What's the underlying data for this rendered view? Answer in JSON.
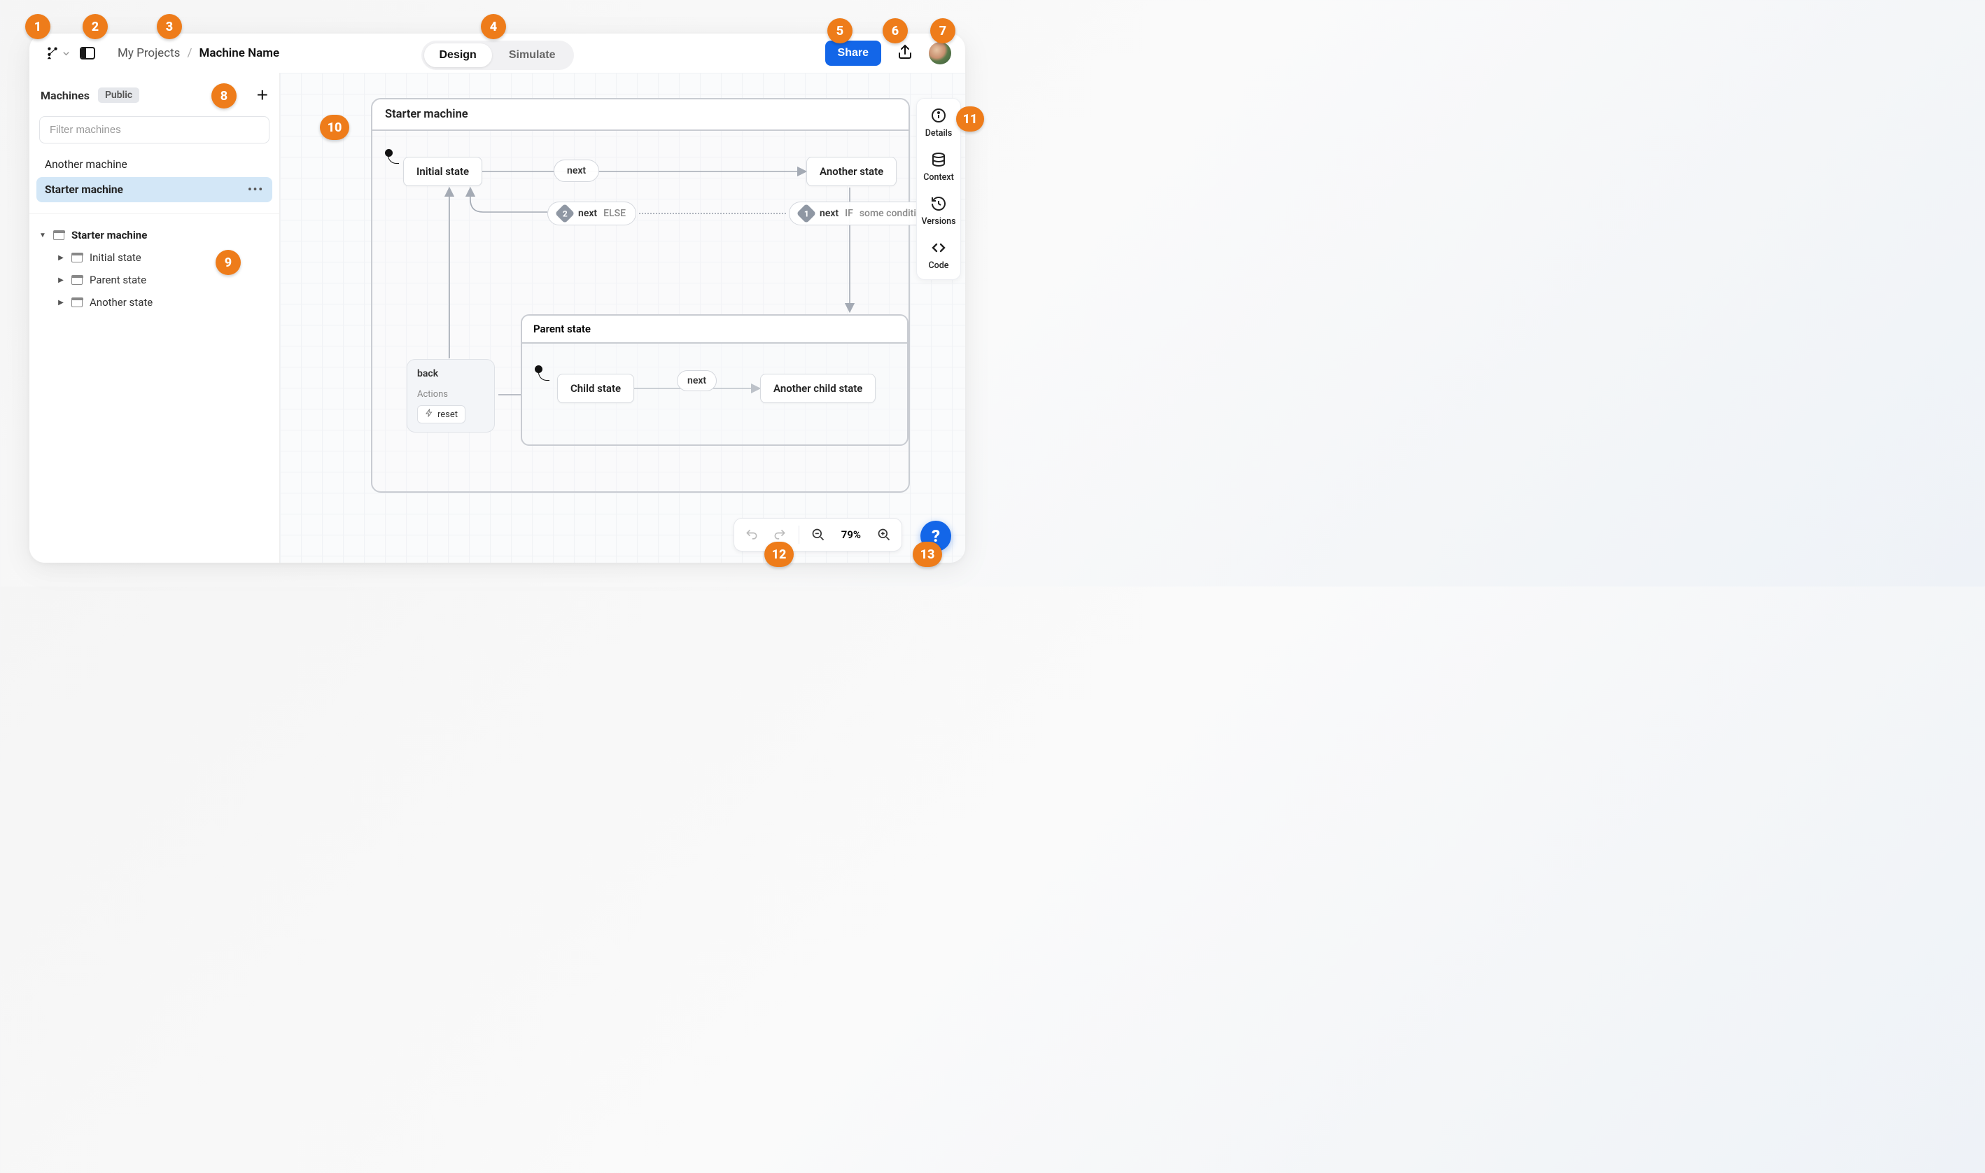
{
  "header": {
    "breadcrumb_root": "My Projects",
    "breadcrumb_sep": "/",
    "breadcrumb_current": "Machine Name",
    "mode_design": "Design",
    "mode_simulate": "Simulate",
    "share_label": "Share"
  },
  "left": {
    "machines_title": "Machines",
    "public_badge": "Public",
    "filter_placeholder": "Filter machines",
    "list": [
      {
        "name": "Another machine",
        "selected": false
      },
      {
        "name": "Starter machine",
        "selected": true
      }
    ],
    "tree": {
      "root": "Starter machine",
      "children": [
        "Initial state",
        "Parent state",
        "Another state"
      ]
    }
  },
  "canvas": {
    "machine_title": "Starter machine",
    "states": {
      "initial": "Initial state",
      "another": "Another state",
      "parent": "Parent state",
      "child": "Child state",
      "child2": "Another child state"
    },
    "events": {
      "next": "next",
      "else": "ELSE",
      "if": "IF",
      "condition": "some conditio",
      "back": "back",
      "actions_label": "Actions",
      "reset": "reset",
      "badge1": "1",
      "badge2": "2"
    }
  },
  "rail": {
    "details": "Details",
    "context": "Context",
    "versions": "Versions",
    "code": "Code"
  },
  "bottom": {
    "zoom": "79%"
  },
  "help": "?",
  "annotations": [
    "1",
    "2",
    "3",
    "4",
    "5",
    "6",
    "7",
    "8",
    "9",
    "10",
    "11",
    "12",
    "13"
  ]
}
